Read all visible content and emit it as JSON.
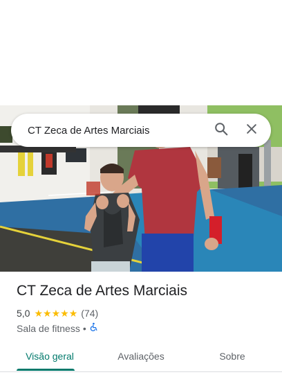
{
  "search": {
    "query": "CT Zeca de Artes Marciais"
  },
  "icons": {
    "search": "search-icon",
    "close": "close-icon",
    "accessibility": "wheelchair-icon"
  },
  "place": {
    "name": "CT Zeca de Artes Marciais",
    "rating": "5,0",
    "stars": 5,
    "review_count": "(74)",
    "category": "Sala de fitness",
    "separator": "•"
  },
  "tabs": [
    {
      "label": "Visão geral",
      "active": true
    },
    {
      "label": "Avaliações",
      "active": false
    },
    {
      "label": "Sobre",
      "active": false
    }
  ],
  "colors": {
    "accent": "#00796b",
    "star": "#fbbc04",
    "accessibility": "#1a73e8"
  }
}
